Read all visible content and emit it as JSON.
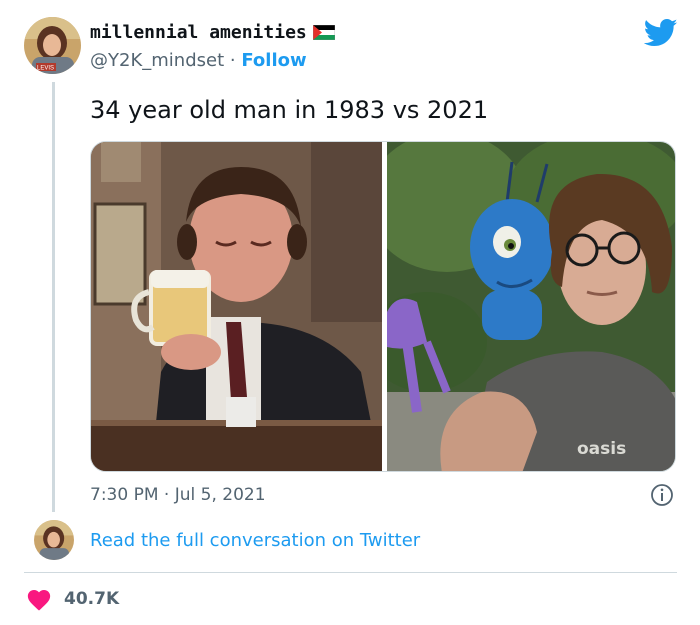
{
  "tweet": {
    "display_name": "millennial amenities",
    "handle": "@Y2K_mindset",
    "separator": "·",
    "follow_label": "Follow",
    "text": "34 year old man in 1983 vs 2021",
    "time": "7:30 PM",
    "date": "Jul 5, 2021",
    "avatar_badge": "LEVIS",
    "shirt_text": "oasis"
  },
  "footer": {
    "read_link": "Read the full conversation on Twitter",
    "like_count": "40.7K"
  },
  "icons": {
    "brand": "twitter-bird-icon",
    "flag": "palestine-flag-icon",
    "info": "info-icon",
    "like": "heart-icon"
  },
  "colors": {
    "accent": "#1d9bf0",
    "text": "#0f1419",
    "muted": "#536471",
    "heart": "#f91880",
    "border": "#cfd9de"
  }
}
